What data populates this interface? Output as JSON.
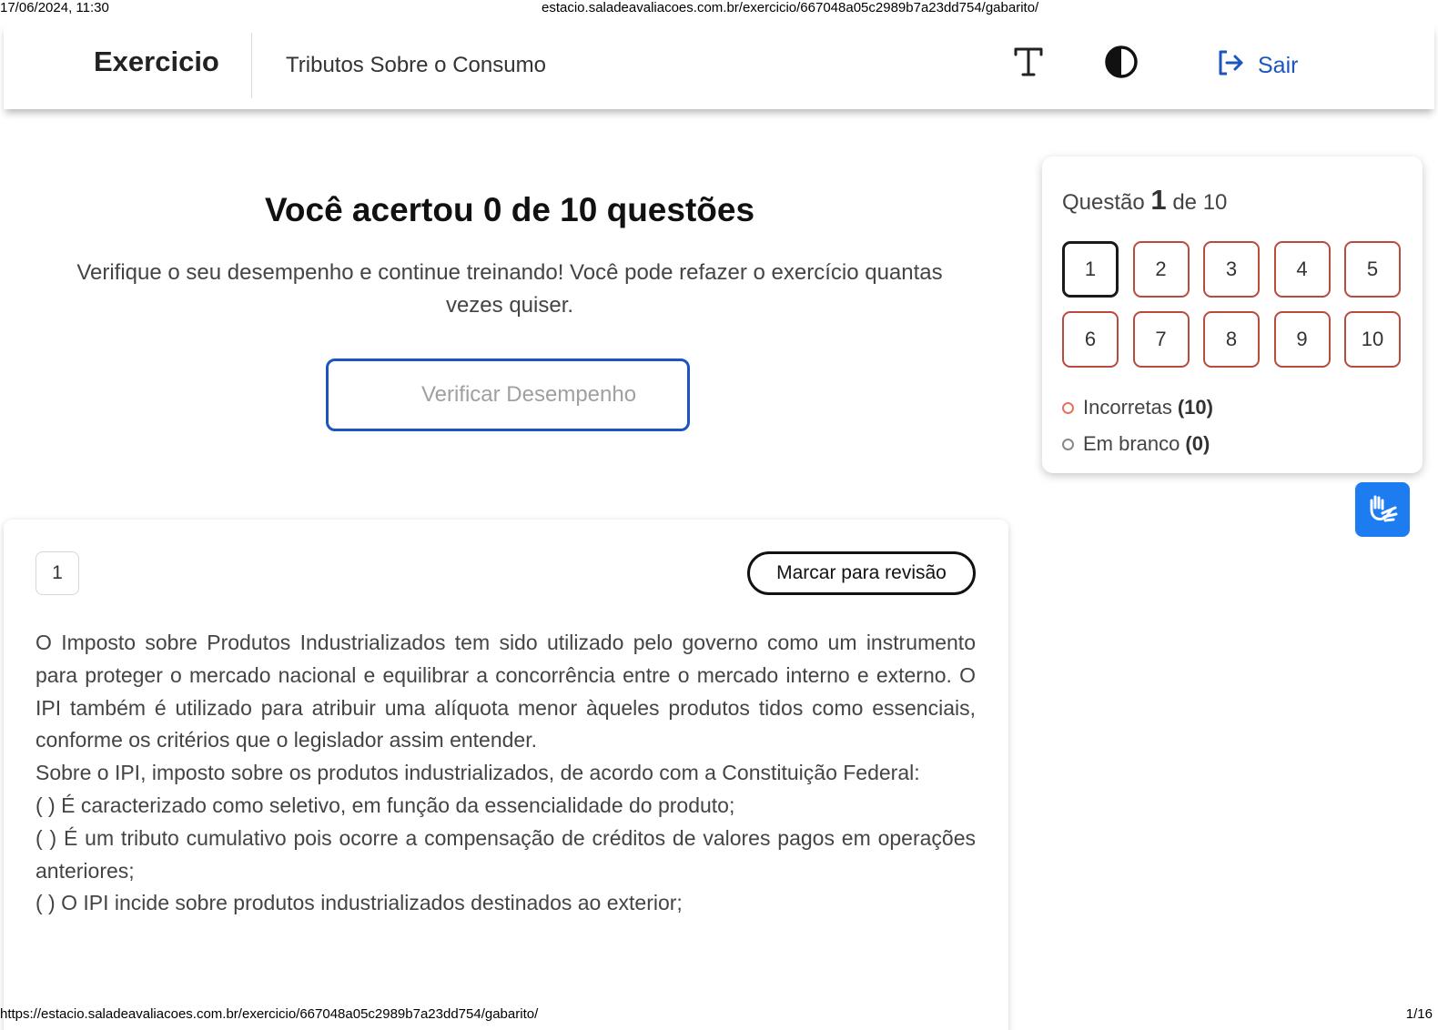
{
  "print_header": {
    "datetime": "17/06/2024, 11:30",
    "url": "estacio.saladeavaliacoes.com.br/exercicio/667048a05c2989b7a23dd754/gabarito/"
  },
  "print_footer": {
    "url": "https://estacio.saladeavaliacoes.com.br/exercicio/667048a05c2989b7a23dd754/gabarito/",
    "page": "1/16"
  },
  "header": {
    "brand": "Exercicio",
    "subject": "Tributos Sobre o Consumo",
    "font_icon": "text-size-icon",
    "contrast_icon": "contrast-icon",
    "logout_label": "Sair",
    "accent": "#1b55c0"
  },
  "result": {
    "title": "Você acertou 0 de 10 questões",
    "subtitle": "Verifique o seu desempenho e continue treinando! Você pode refazer o exercício quantas vezes quiser.",
    "button_label": "Verificar Desempenho"
  },
  "navigator": {
    "prefix": "Questão",
    "current": "1",
    "suffix": "de 10",
    "questions": [
      "1",
      "2",
      "3",
      "4",
      "5",
      "6",
      "7",
      "8",
      "9",
      "10"
    ],
    "legend": {
      "incorrect_label": "Incorretas",
      "incorrect_count": "(10)",
      "blank_label": "Em branco",
      "blank_count": "(0)"
    },
    "incorrect_color": "#b84a3e"
  },
  "accessibility": {
    "icon": "sign-language-icon",
    "color": "#1c7cf0"
  },
  "question": {
    "number": "1",
    "review_label": "Marcar para revisão",
    "paragraphs": [
      "O Imposto sobre Produtos Industrializados tem sido utilizado pelo governo como um instrumento para proteger o mercado nacional e equilibrar a concorrência entre o mercado interno e externo. O IPI também é utilizado para atribuir uma alíquota menor àqueles produtos tidos como essenciais, conforme os critérios que o legislador assim entender.",
      "Sobre o IPI, imposto sobre os produtos industrializados, de acordo com a Constituição Federal:",
      "(   ) É caracterizado como seletivo, em função da essencialidade do produto;",
      "(   ) É um tributo cumulativo pois ocorre a compensação de créditos de valores pagos em operações anteriores;",
      "(   ) O IPI incide sobre produtos industrializados destinados ao exterior;"
    ]
  }
}
